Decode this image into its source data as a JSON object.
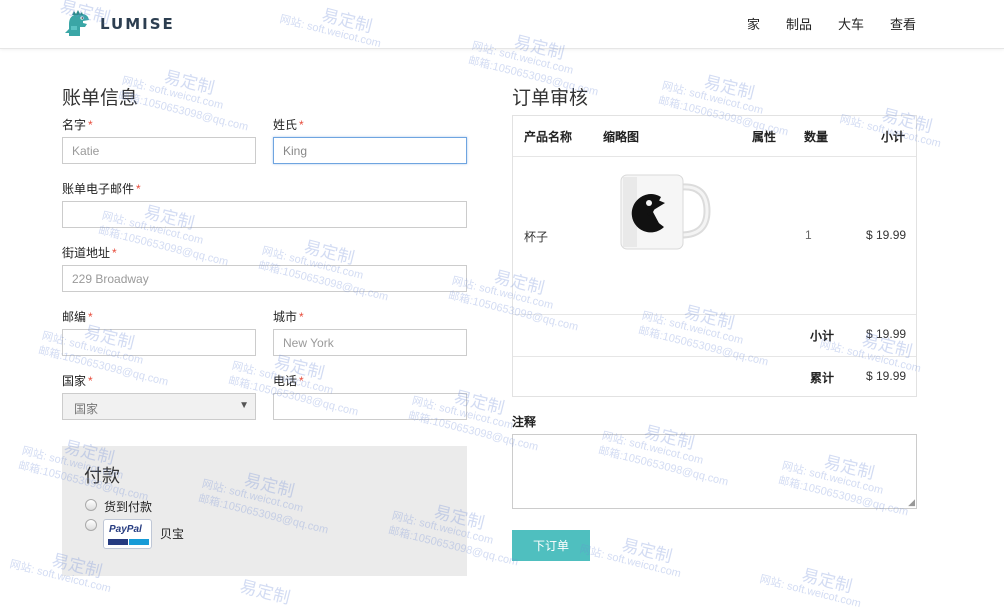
{
  "header": {
    "logo_text": "LUMISE",
    "nav": [
      "家",
      "制品",
      "大车",
      "查看"
    ]
  },
  "billing": {
    "title": "账单信息",
    "first_name": {
      "label": "名字",
      "required_mark": "*",
      "value": "Katie"
    },
    "last_name": {
      "label": "姓氏",
      "required_mark": "*",
      "value": "King"
    },
    "email": {
      "label": "账单电子邮件",
      "required_mark": "*",
      "value": ""
    },
    "street": {
      "label": "街道地址",
      "required_mark": "*",
      "value": "229 Broadway"
    },
    "zip": {
      "label": "邮编",
      "required_mark": "*",
      "value": ""
    },
    "city": {
      "label": "城市",
      "required_mark": "*",
      "value": "New York"
    },
    "country": {
      "label": "国家",
      "required_mark": "*",
      "selected": "国家"
    },
    "phone": {
      "label": "电话",
      "required_mark": "*",
      "value": ""
    }
  },
  "payment": {
    "title": "付款",
    "options": [
      {
        "label": "货到付款",
        "selected": false
      },
      {
        "label": "贝宝",
        "selected": false,
        "logo_text": "PayPal"
      }
    ]
  },
  "order": {
    "title": "订单审核",
    "columns": [
      "产品名称",
      "缩略图",
      "属性",
      "数量",
      "小计"
    ],
    "items": [
      {
        "name": "杯子",
        "thumbnail": "pacman-mug-image",
        "attributes": "",
        "quantity": "1",
        "subtotal": "$ 19.99"
      }
    ],
    "subtotal_label": "小计",
    "subtotal_value": "$ 19.99",
    "total_label": "累计",
    "total_value": "$ 19.99"
  },
  "notes": {
    "label": "注释",
    "value": ""
  },
  "place_order_label": "下订单",
  "watermark": {
    "brand": "易定制",
    "site": "网站: soft.weicot.com",
    "mail": "邮箱:1050653098@qq.com"
  },
  "colors": {
    "accent_button": "#4fbfbf",
    "required": "#e74c3c",
    "focus_border": "#6fa5e0",
    "payment_bg": "#ebebeb"
  }
}
